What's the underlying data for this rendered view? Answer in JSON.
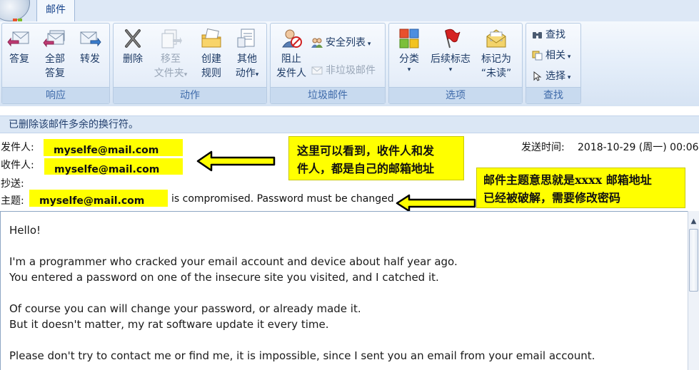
{
  "tabs": {
    "mail": "邮件"
  },
  "ribbon": {
    "respond": {
      "label": "响应",
      "reply": [
        "答复",
        ""
      ],
      "reply_all": [
        "全部",
        "答复"
      ],
      "forward": [
        "转发",
        ""
      ]
    },
    "actions": {
      "label": "动作",
      "delete": [
        "删除",
        ""
      ],
      "move_to_folder": [
        "移至",
        "文件夹"
      ],
      "create_rule": [
        "创建",
        "规则"
      ],
      "other_actions": [
        "其他",
        "动作"
      ]
    },
    "junk": {
      "label": "垃圾邮件",
      "block_sender": [
        "阻止",
        "发件人"
      ],
      "safe_lists": "安全列表",
      "not_junk": "非垃圾邮件"
    },
    "options": {
      "label": "选项",
      "categorize": "分类",
      "follow_up": "后续标志",
      "mark_unread": [
        "标记为",
        "“未读”"
      ]
    },
    "find": {
      "label": "查找",
      "find": "查找",
      "related": "相关",
      "select": "选择"
    }
  },
  "infobar": {
    "text": "已删除该邮件多余的换行符。"
  },
  "header": {
    "from_label": "发件人:",
    "from_value": "myselfe@mail.com",
    "to_label": "收件人:",
    "to_value": "myselfe@mail.com",
    "cc_label": "抄送:",
    "subject_label": "主题:",
    "subject_highlight": "myselfe@mail.com",
    "subject_rest": "is compromised. Password must be changed",
    "sent_label": "发送时间:",
    "sent_value": "2018-10-29 (周一) 00:06"
  },
  "annotations": {
    "callout1": [
      "这里可以看到，收件人和发",
      "件人，都是自己的邮箱地址"
    ],
    "callout2": [
      "邮件主题意思就是xxxx 邮箱地址",
      "已经被破解，需要修改密码"
    ],
    "color": "#ffff00"
  },
  "body": {
    "lines": [
      "Hello!",
      "I'm a programmer who cracked your email account and device about half year ago.",
      "You entered a password on one of the insecure site you visited, and I catched it.",
      "Of course you can will change your password, or already made it.",
      "But it doesn't matter, my rat software update it every time.",
      "Please don't try to contact me or find me, it is impossible, since I sent you an email from your email account."
    ]
  },
  "icons": [
    "office-button-icon",
    "reply-icon",
    "reply-all-icon",
    "forward-icon",
    "delete-icon",
    "move-to-folder-icon",
    "create-rule-icon",
    "other-actions-icon",
    "block-sender-icon",
    "safe-lists-icon",
    "not-junk-icon",
    "categorize-icon",
    "follow-up-flag-icon",
    "mark-unread-icon",
    "find-icon",
    "related-icon",
    "select-icon",
    "arrow-left-icon",
    "scroll-up-icon"
  ]
}
